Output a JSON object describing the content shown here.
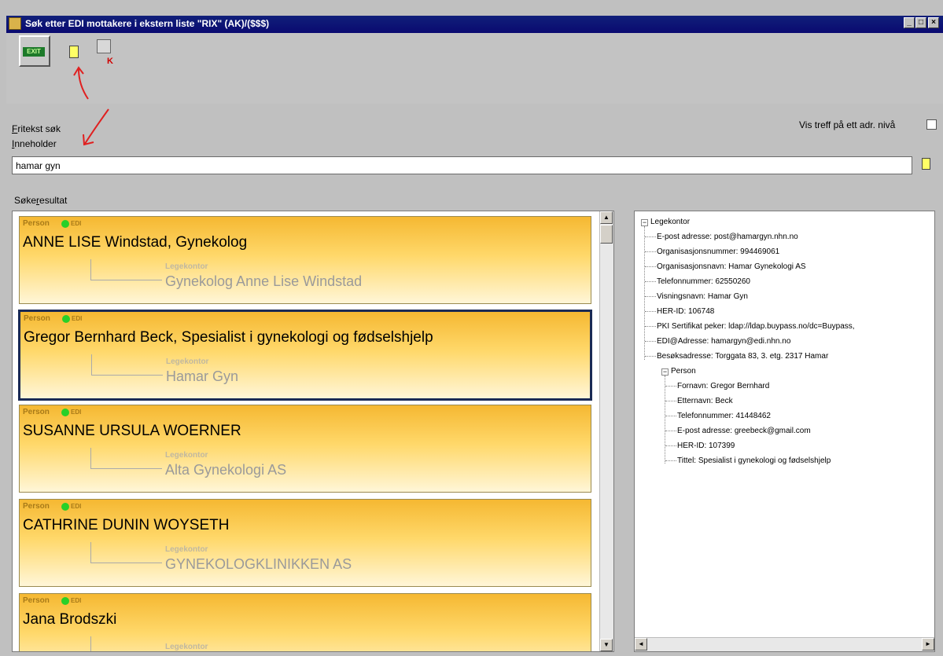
{
  "window": {
    "title": "Søk etter EDI mottakere i ekstern liste \"RIX\" (AK)/($$$)",
    "controls": [
      "_",
      "□",
      "×"
    ]
  },
  "toolbar": {
    "exit_label": "EXIT",
    "k_label": "K"
  },
  "search": {
    "fritekst_label_first": "F",
    "fritekst_label_rest": "ritekst søk",
    "inneholder_label_first": "I",
    "inneholder_label_rest": "nneholder",
    "value": "hamar gyn",
    "checkbox_label": "Vis treff på ett adr. nivå"
  },
  "results": {
    "label_pre": "Søke",
    "label_underlined": "r",
    "label_post": "esultat",
    "items": [
      {
        "type": "Person",
        "edi": "EDI",
        "name": "ANNE LISE Windstad, Gynekolog",
        "sublabel": "Legekontor",
        "org": "Gynekolog Anne Lise Windstad"
      },
      {
        "type": "Person",
        "edi": "EDI",
        "name": "Gregor Bernhard Beck, Spesialist i gynekologi og fødselshjelp",
        "sublabel": "Legekontor",
        "org": "Hamar Gyn"
      },
      {
        "type": "Person",
        "edi": "EDI",
        "name": "SUSANNE URSULA WOERNER",
        "sublabel": "Legekontor",
        "org": "Alta Gynekologi AS"
      },
      {
        "type": "Person",
        "edi": "EDI",
        "name": "CATHRINE DUNIN WOYSETH",
        "sublabel": "Legekontor",
        "org": "GYNEKOLOGKLINIKKEN AS"
      },
      {
        "type": "Person",
        "edi": "EDI",
        "name": "Jana Brodszki",
        "sublabel": "Legekontor",
        "org": ""
      }
    ]
  },
  "details": {
    "root": "Legekontor",
    "legekontor_fields": [
      "E-post adresse: post@hamargyn.nhn.no",
      "Organisasjonsnummer: 994469061",
      "Organisasjonsnavn: Hamar Gynekologi AS",
      "Telefonnummer: 62550260",
      "Visningsnavn: Hamar Gyn",
      "HER-ID: 106748",
      "PKI Sertifikat peker: ldap://ldap.buypass.no/dc=Buypass,",
      "EDI@Adresse: hamargyn@edi.nhn.no",
      "Besøksadresse: Torggata 83, 3. etg.  2317 Hamar"
    ],
    "person_node": "Person",
    "person_fields": [
      "Fornavn: Gregor Bernhard",
      "Etternavn: Beck",
      "Telefonnummer: 41448462",
      "E-post adresse: greebeck@gmail.com",
      "HER-ID: 107399",
      "Tittel: Spesialist i gynekologi og fødselshjelp"
    ]
  },
  "colors": {
    "titlebar": "#0a0a70",
    "card_top": "#f5b832",
    "edi_dot": "#28d028",
    "annotation": "#e02020"
  }
}
